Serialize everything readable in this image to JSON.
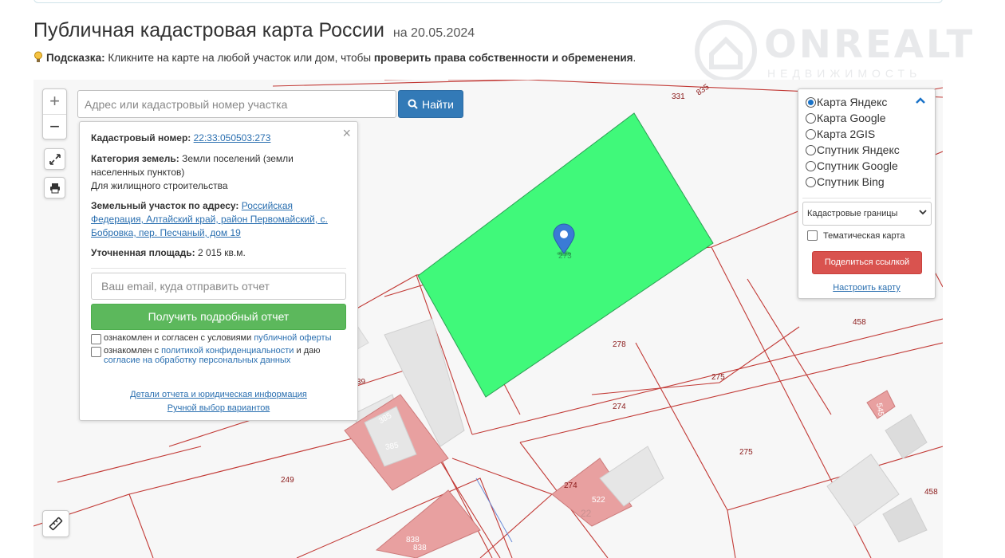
{
  "header": {
    "title": "Публичная кадастровая карта России",
    "date": "на 20.05.2024",
    "hint_label": "Подсказка:",
    "hint_text": " Кликните на карте на любой участок или дом, чтобы ",
    "hint_bold": "проверить права собственности и обременения",
    "hint_end": "."
  },
  "watermark": {
    "brand": "ONREALT",
    "sub": "НЕДВИЖИМОСТЬ"
  },
  "map_controls": {
    "zoom_in": "+",
    "zoom_out": "−",
    "fullscreen_icon": "expand-icon",
    "print_icon": "printer-icon",
    "ruler_icon": "ruler-icon"
  },
  "search": {
    "placeholder": "Адрес или кадастровый номер участка",
    "button_label": "Найти"
  },
  "info_panel": {
    "close": "×",
    "cadastral_label": "Кадастровый номер:",
    "cadastral_value": "22:33:050503:273",
    "category_label": "Категория земель:",
    "category_value": "Земли поселений (земли",
    "category_value_2": "населенных пунктов)",
    "usage": "Для жилищного строительства",
    "address_label": "Земельный участок по адресу:",
    "address_value_1": "Российская",
    "address_value_2": "Федерация, Алтайский край, район Первомайский, с.",
    "address_value_3": "Бобровка, пер. Песчаный, дом 19",
    "area_label": "Уточненная площадь:",
    "area_value": "2 015 кв.м.",
    "email_placeholder": "Ваш email, куда отправить отчет",
    "report_button": "Получить подробный отчет",
    "agree1_text": "ознакомлен и согласен с условиями ",
    "agree1_link": "публичной оферты",
    "agree2_text": "ознакомлен с ",
    "agree2_link": "политикой конфиденциальности",
    "agree2_tail": " и даю",
    "agree2_link2": "согласие на обработку персональных данных",
    "details_link": "Детали отчета и юридическая информация",
    "manual_link": "Ручной выбор вариантов"
  },
  "layers": {
    "options": [
      {
        "label": "Карта Яндекс",
        "selected": true
      },
      {
        "label": "Карта Google",
        "selected": false
      },
      {
        "label": "Карта 2GIS",
        "selected": false
      },
      {
        "label": "Спутник Яндекс",
        "selected": false
      },
      {
        "label": "Спутник Google",
        "selected": false
      },
      {
        "label": "Спутник Bing",
        "selected": false
      }
    ],
    "boundaries_select": "Кадастровые границы",
    "thematic_label": "Тематическая карта",
    "share_button": "Поделиться ссылкой",
    "configure_link": "Настроить карту"
  },
  "map_labels": {
    "l331": "331",
    "l835": "835",
    "l273": "273",
    "l278": "278",
    "l275a": "275",
    "l274a": "274",
    "l275b": "275",
    "l458a": "458",
    "l458b": "458",
    "l385a": "385",
    "l385b": "385",
    "l249": "249",
    "l39": "39",
    "l274b": "274",
    "l522": "522",
    "l22": "22",
    "l838a": "838",
    "l838b": "838",
    "l545": "545"
  },
  "colors": {
    "selected_parcel": "#40f97a",
    "parcel_border": "#c23a36",
    "building": "#e8a0a0",
    "primary_button": "#337ab7",
    "report_button": "#5cb85c",
    "share_button": "#d9534f"
  }
}
